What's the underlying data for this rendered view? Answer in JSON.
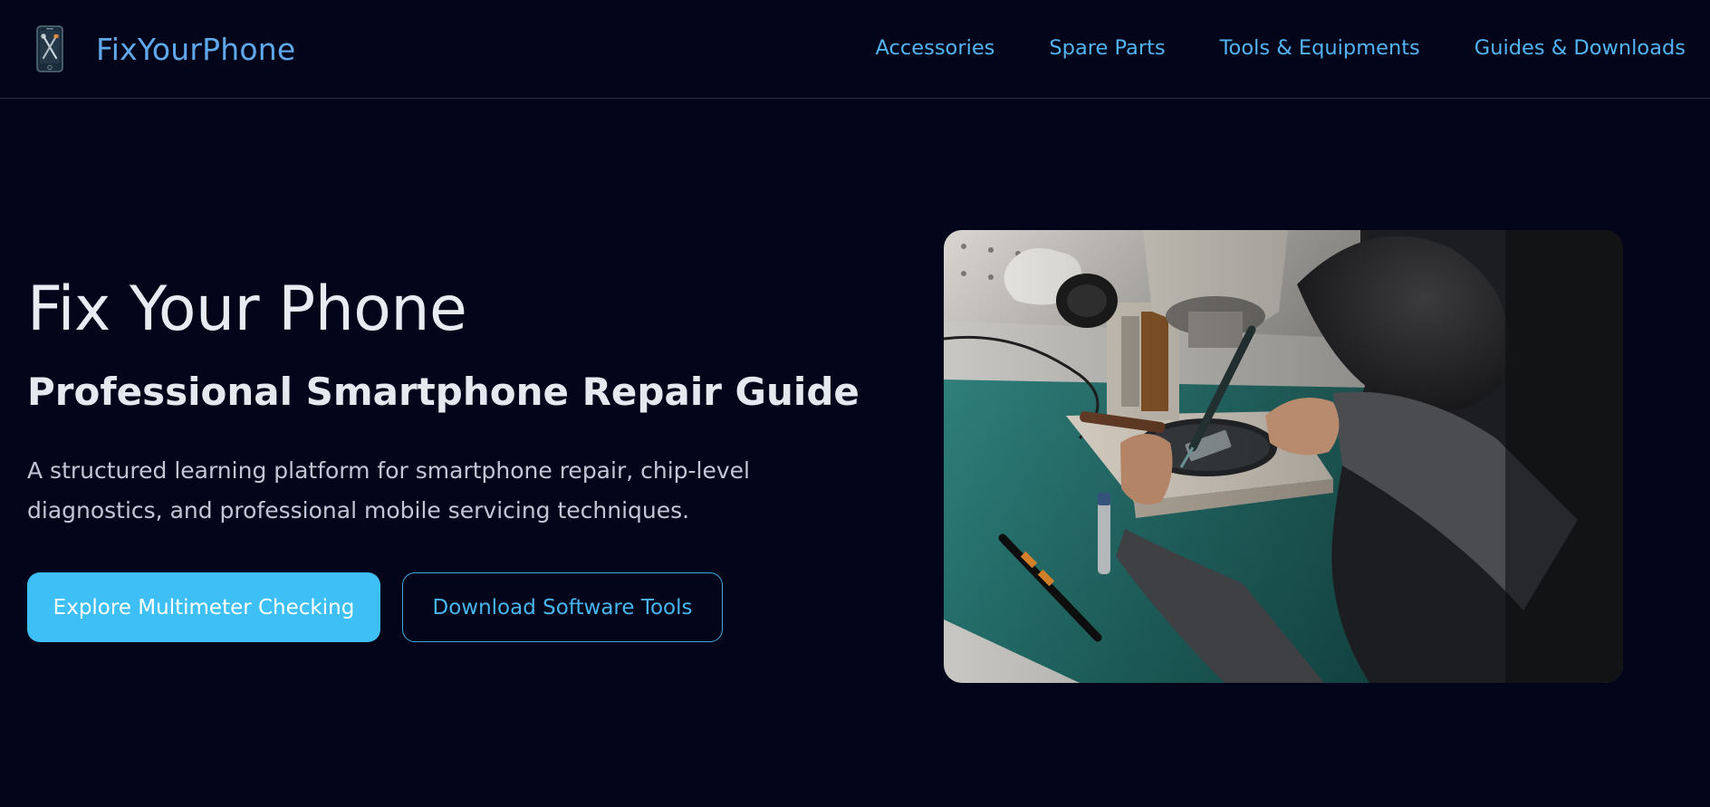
{
  "header": {
    "brand": "FixYourPhone",
    "logo_icon": "phone-tools-icon",
    "nav": [
      "Accessories",
      "Spare Parts",
      "Tools & Equipments",
      "Guides & Downloads"
    ]
  },
  "hero": {
    "title": "Fix Your Phone",
    "subtitle": "Professional Smartphone Repair Guide",
    "description": "A structured learning platform for smartphone repair, chip-level diagnostics, and professional mobile servicing techniques.",
    "primary_button": "Explore Multimeter Checking",
    "secondary_button": "Download Software Tools",
    "image_icon": "technician-microscope-photo"
  },
  "colors": {
    "background": "#03061a",
    "brand": "#5fa8ec",
    "nav": "#52b4f4",
    "primary_button": "#3ebff5",
    "heading": "#e9ebf2"
  }
}
